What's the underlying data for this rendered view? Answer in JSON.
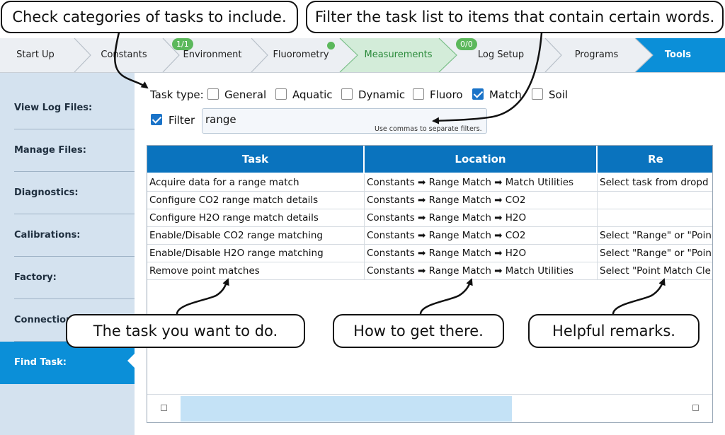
{
  "steps": [
    {
      "label": "Start Up"
    },
    {
      "label": "Constants"
    },
    {
      "label": "Environment",
      "badge": "1/1"
    },
    {
      "label": "Fluorometry"
    },
    {
      "label": "Measurements"
    },
    {
      "label": "Log Setup",
      "badge": "0/0"
    },
    {
      "label": "Programs"
    },
    {
      "label": "Tools"
    }
  ],
  "sidebar": {
    "items": [
      {
        "label": "View Log Files:"
      },
      {
        "label": "Manage Files:"
      },
      {
        "label": "Diagnostics:"
      },
      {
        "label": "Calibrations:"
      },
      {
        "label": "Factory:"
      },
      {
        "label": "Connections:"
      },
      {
        "label": "Find Task:"
      }
    ]
  },
  "task_type": {
    "label": "Task type:",
    "options": [
      {
        "label": "General",
        "checked": false
      },
      {
        "label": "Aquatic",
        "checked": false
      },
      {
        "label": "Dynamic",
        "checked": false
      },
      {
        "label": "Fluoro",
        "checked": false
      },
      {
        "label": "Match",
        "checked": true
      },
      {
        "label": "Soil",
        "checked": false
      }
    ]
  },
  "filter": {
    "label": "Filter",
    "checked": true,
    "value": "range",
    "hint": "Use commas to separate filters."
  },
  "table": {
    "headers": [
      "Task",
      "Location",
      "Re"
    ],
    "rows": [
      [
        "Acquire data for a range match",
        "Constants ➡ Range Match ➡ Match Utilities",
        "Select task from dropd"
      ],
      [
        "Configure CO2 range match details",
        "Constants ➡ Range Match ➡ CO2",
        ""
      ],
      [
        "Configure H2O range match details",
        "Constants ➡ Range Match ➡ H2O",
        ""
      ],
      [
        "Enable/Disable CO2 range matching",
        "Constants ➡ Range Match ➡ CO2",
        "Select \"Range\" or \"Poin"
      ],
      [
        "Enable/Disable H2O range matching",
        "Constants ➡ Range Match ➡ H2O",
        "Select \"Range\" or \"Poin"
      ],
      [
        "Remove point matches",
        "Constants ➡ Range Match ➡ Match Utilities",
        "Select \"Point Match Cle"
      ]
    ]
  },
  "callouts": {
    "categories": "Check categories of tasks to include.",
    "filter": "Filter the task list to items that contain certain words.",
    "task": "The task you want to do.",
    "location": "How to get there.",
    "remarks": "Helpful remarks."
  },
  "colors": {
    "accent": "#0b8fd8",
    "header": "#0a73be",
    "badge": "#5cb85c",
    "measurements_bg": "#d3ecd9",
    "sidebar_bg": "#d4e2ef"
  }
}
